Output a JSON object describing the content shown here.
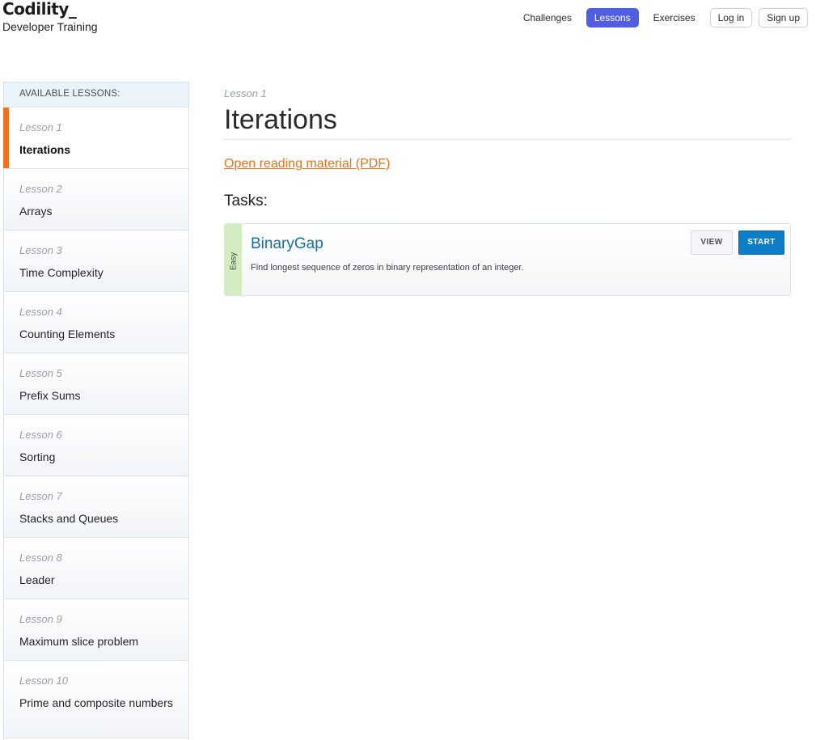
{
  "header": {
    "logo": "Codility_",
    "subtitle": "Developer Training",
    "nav": [
      {
        "label": "Challenges"
      },
      {
        "label": "Lessons"
      },
      {
        "label": "Exercises"
      },
      {
        "label": "Log in"
      },
      {
        "label": "Sign up"
      }
    ]
  },
  "sidebar": {
    "title": "AVAILABLE LESSONS:",
    "lessons": [
      {
        "num": "Lesson 1",
        "name": "Iterations"
      },
      {
        "num": "Lesson 2",
        "name": "Arrays"
      },
      {
        "num": "Lesson 3",
        "name": "Time Complexity"
      },
      {
        "num": "Lesson 4",
        "name": "Counting Elements"
      },
      {
        "num": "Lesson 5",
        "name": "Prefix Sums"
      },
      {
        "num": "Lesson 6",
        "name": "Sorting"
      },
      {
        "num": "Lesson 7",
        "name": "Stacks and Queues"
      },
      {
        "num": "Lesson 8",
        "name": "Leader"
      },
      {
        "num": "Lesson 9",
        "name": "Maximum slice problem"
      },
      {
        "num": "Lesson 10",
        "name": "Prime and composite numbers"
      }
    ]
  },
  "main": {
    "kicker": "Lesson 1",
    "title": "Iterations",
    "pdf_link": "Open reading material (PDF)",
    "tasks_label": "Tasks:",
    "task": {
      "difficulty": "Easy",
      "name": "BinaryGap",
      "description": "Find longest sequence of zeros in binary representation of an integer.",
      "view_label": "VIEW",
      "start_label": "START"
    }
  },
  "colors": {
    "accent_orange": "#f2701c",
    "nav_active": "#4f5fe0",
    "task_link": "#1b6f9e",
    "start_button": "#0e7dc7",
    "easy_strip": "#d3ecc2"
  }
}
